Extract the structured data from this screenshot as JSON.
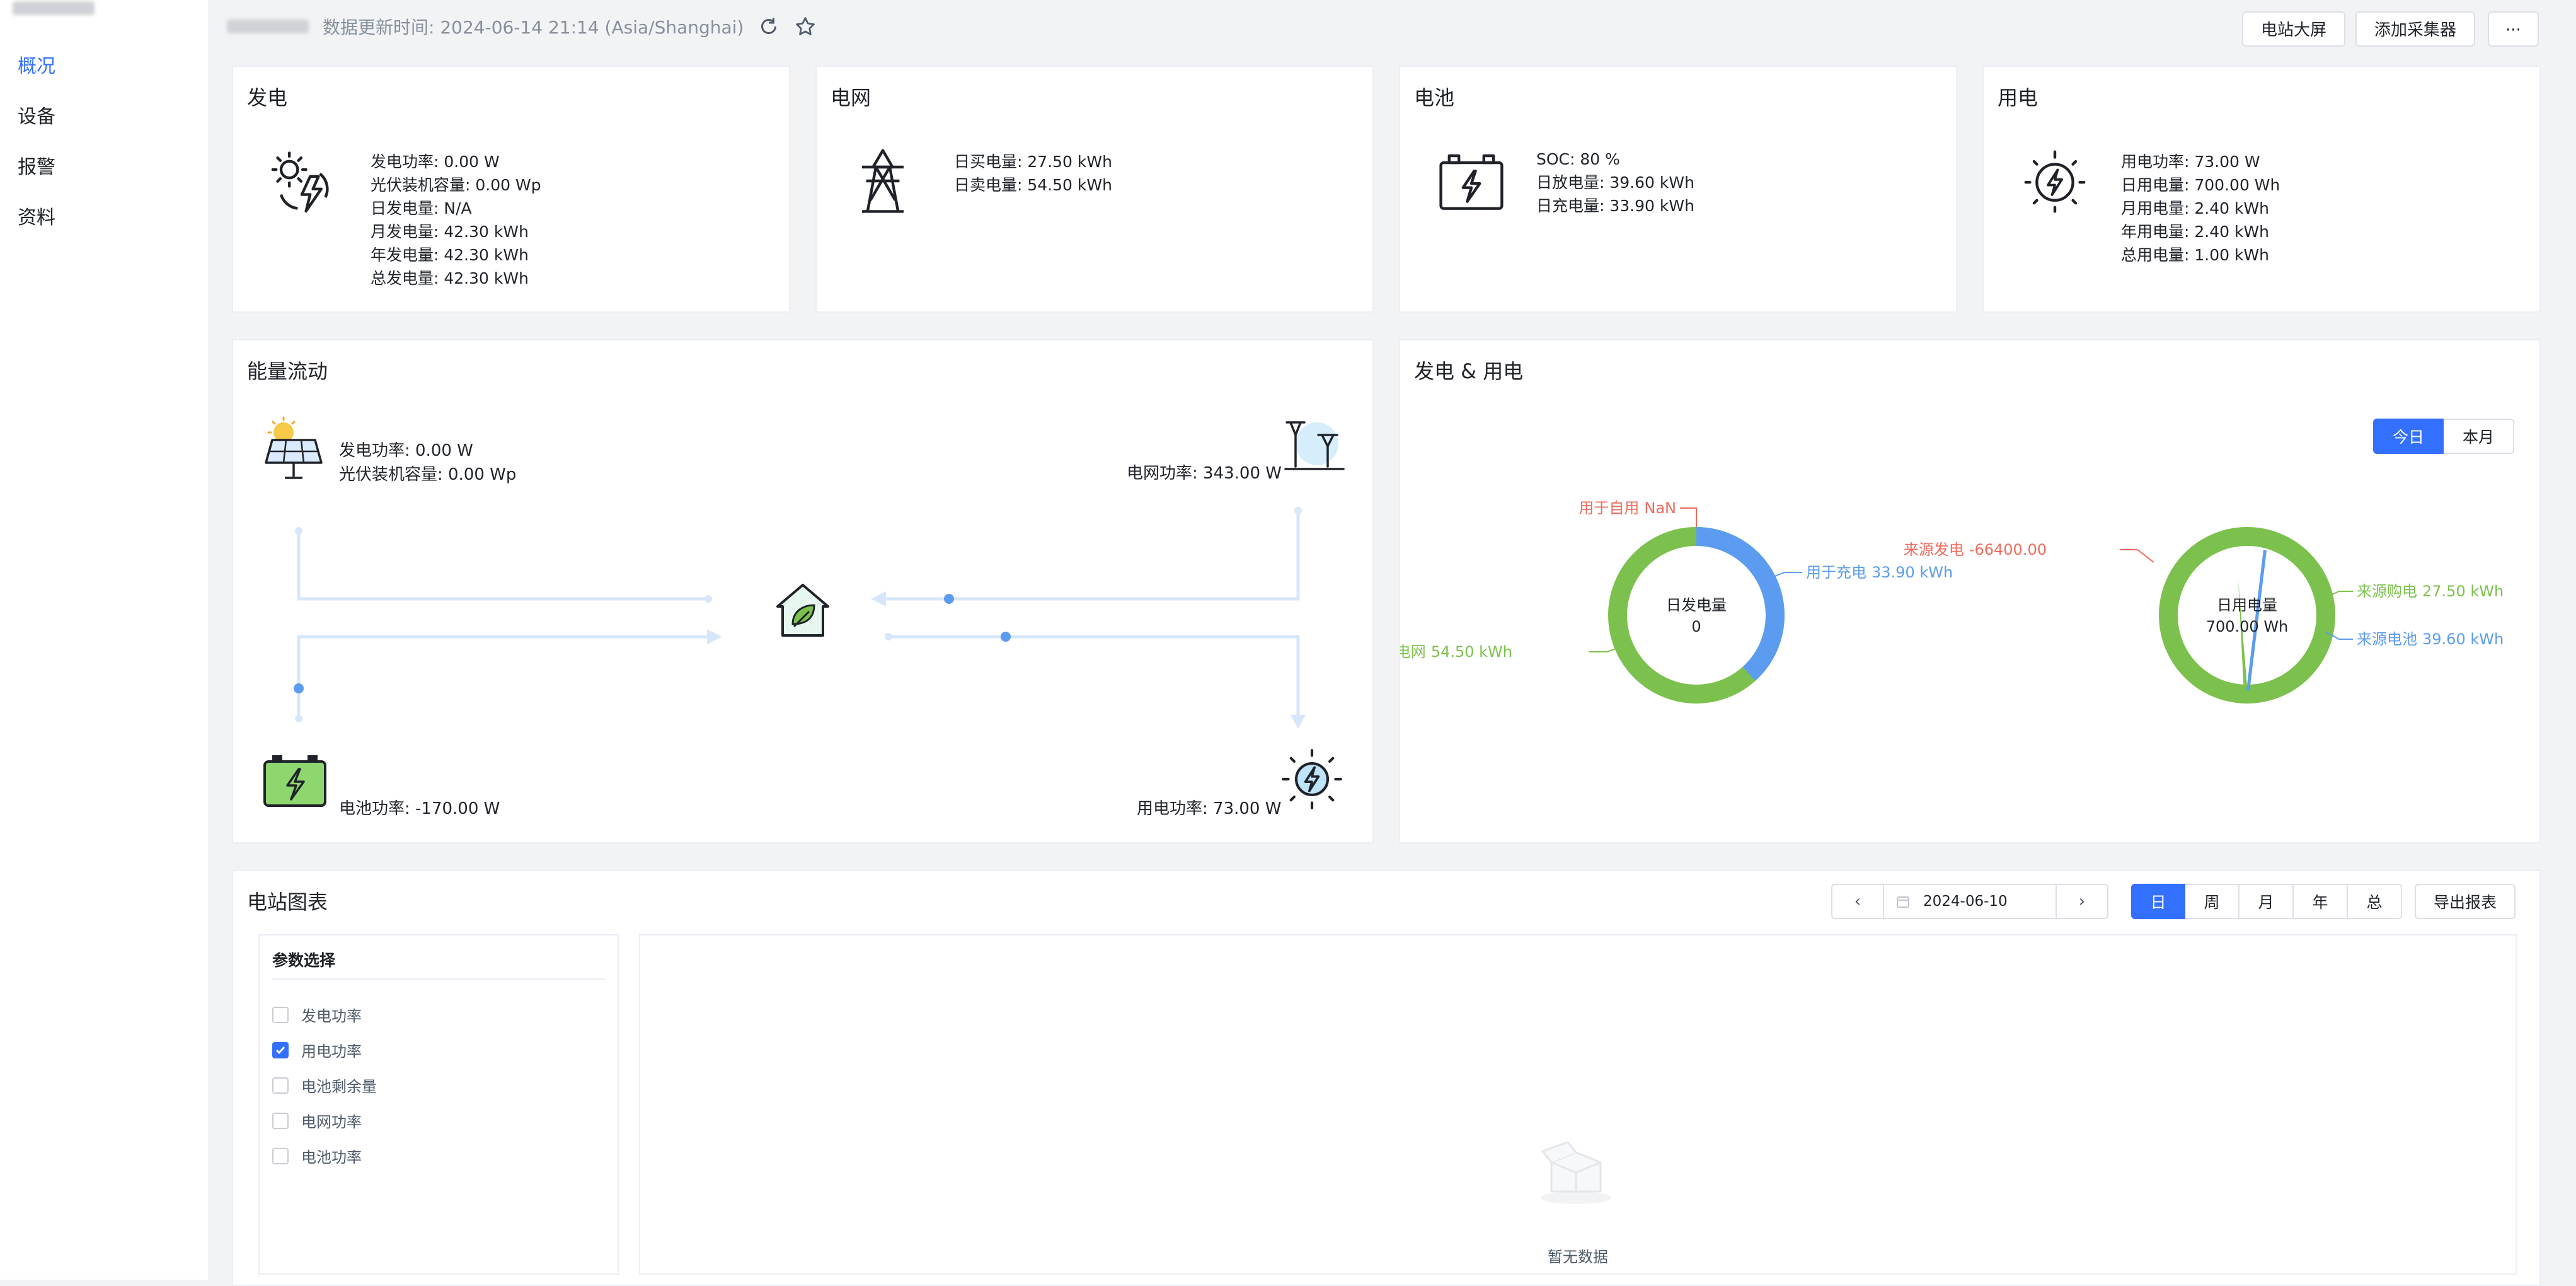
{
  "nav": {
    "items": [
      {
        "label": "概况",
        "active": true
      },
      {
        "label": "设备",
        "active": false
      },
      {
        "label": "报警",
        "active": false
      },
      {
        "label": "资料",
        "active": false
      }
    ]
  },
  "header": {
    "update_text": "数据更新时间: 2024-06-14 21:14 (Asia/Shanghai)",
    "btn_screen": "电站大屏",
    "btn_add_collector": "添加采集器",
    "btn_more": "···"
  },
  "cards": {
    "generation": {
      "title": "发电",
      "lines": [
        "发电功率: 0.00 W",
        "光伏装机容量: 0.00 Wp",
        "日发电量: N/A",
        "月发电量: 42.30 kWh",
        "年发电量: 42.30 kWh",
        "总发电量: 42.30 kWh"
      ]
    },
    "grid": {
      "title": "电网",
      "lines": [
        "日买电量: 27.50 kWh",
        "日卖电量: 54.50 kWh"
      ]
    },
    "battery": {
      "title": "电池",
      "lines": [
        "SOC: 80 %",
        "日放电量: 39.60 kWh",
        "日充电量: 33.90 kWh"
      ]
    },
    "consumption": {
      "title": "用电",
      "lines": [
        "用电功率: 73.00 W",
        "日用电量: 700.00 Wh",
        "月用电量: 2.40 kWh",
        "年用电量: 2.40 kWh",
        "总用电量: 1.00 kWh"
      ]
    }
  },
  "energy_flow": {
    "title": "能量流动",
    "pv_power": "发电功率: 0.00 W",
    "pv_capacity": "光伏装机容量: 0.00 Wp",
    "grid_power": "电网功率: 343.00 W",
    "battery_power": "电池功率: -170.00 W",
    "load_power": "用电功率: 73.00 W"
  },
  "gen_use": {
    "title": "发电 & 用电",
    "tab_today": "今日",
    "tab_month": "本月"
  },
  "station_chart": {
    "title": "电站图表",
    "date": "2024-06-10",
    "periods": [
      "日",
      "周",
      "月",
      "年",
      "总"
    ],
    "export": "导出报表",
    "param_title": "参数选择",
    "params": [
      {
        "label": "发电功率",
        "checked": false
      },
      {
        "label": "用电功率",
        "checked": true
      },
      {
        "label": "电池剩余量",
        "checked": false
      },
      {
        "label": "电网功率",
        "checked": false
      },
      {
        "label": "电池功率",
        "checked": false
      }
    ],
    "empty_text": "暂无数据"
  },
  "chart_data": [
    {
      "type": "pie",
      "center_label": "日发电量",
      "center_value": "0",
      "slices": [
        {
          "label": "用于自用",
          "value_text": "NaN",
          "value": null,
          "color": "#ee6b5e"
        },
        {
          "label": "用于充电",
          "value_text": "33.90 kWh",
          "value": 33.9,
          "color": "#5b9cf0"
        },
        {
          "label": "用于电网",
          "value_text": "54.50 kWh",
          "value": 54.5,
          "color": "#7cc14d"
        }
      ]
    },
    {
      "type": "pie",
      "center_label": "日用电量",
      "center_value": "700.00 Wh",
      "slices": [
        {
          "label": "来源发电",
          "value_text": "-66400.00",
          "value": -66400.0,
          "color": "#ee6b5e"
        },
        {
          "label": "来源购电",
          "value_text": "27.50 kWh",
          "value": 27.5,
          "color": "#7cc14d"
        },
        {
          "label": "来源电池",
          "value_text": "39.60 kWh",
          "value": 39.6,
          "color": "#5b9cf0"
        }
      ]
    }
  ],
  "colors": {
    "accent": "#3370ff",
    "green": "#7cc14d",
    "blue": "#5b9cf0",
    "red": "#ee6b5e"
  }
}
